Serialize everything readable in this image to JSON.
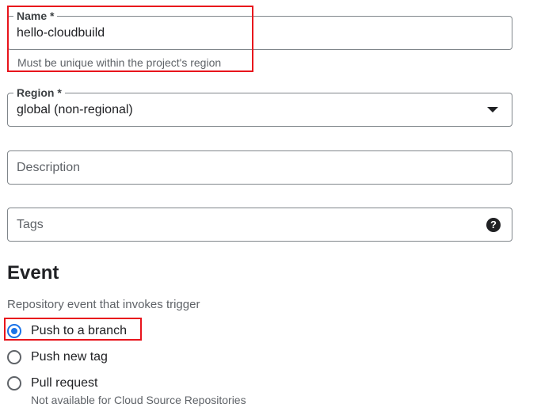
{
  "name_field": {
    "label": "Name *",
    "value": "hello-cloudbuild",
    "hint": "Must be unique within the project's region"
  },
  "region_field": {
    "label": "Region *",
    "value": "global (non-regional)",
    "icon": "chevron-down-icon"
  },
  "description_field": {
    "placeholder": "Description"
  },
  "tags_field": {
    "placeholder": "Tags",
    "icon": "help-icon",
    "icon_glyph": "?"
  },
  "event_section": {
    "title": "Event",
    "subtitle": "Repository event that invokes trigger",
    "options": [
      {
        "label": "Push to a branch",
        "selected": true
      },
      {
        "label": "Push new tag",
        "selected": false
      },
      {
        "label": "Pull request",
        "selected": false,
        "hint": "Not available for Cloud Source Repositories"
      }
    ]
  },
  "colors": {
    "accent": "#1a73e8",
    "highlight": "#e8141c",
    "border": "#80868b"
  }
}
